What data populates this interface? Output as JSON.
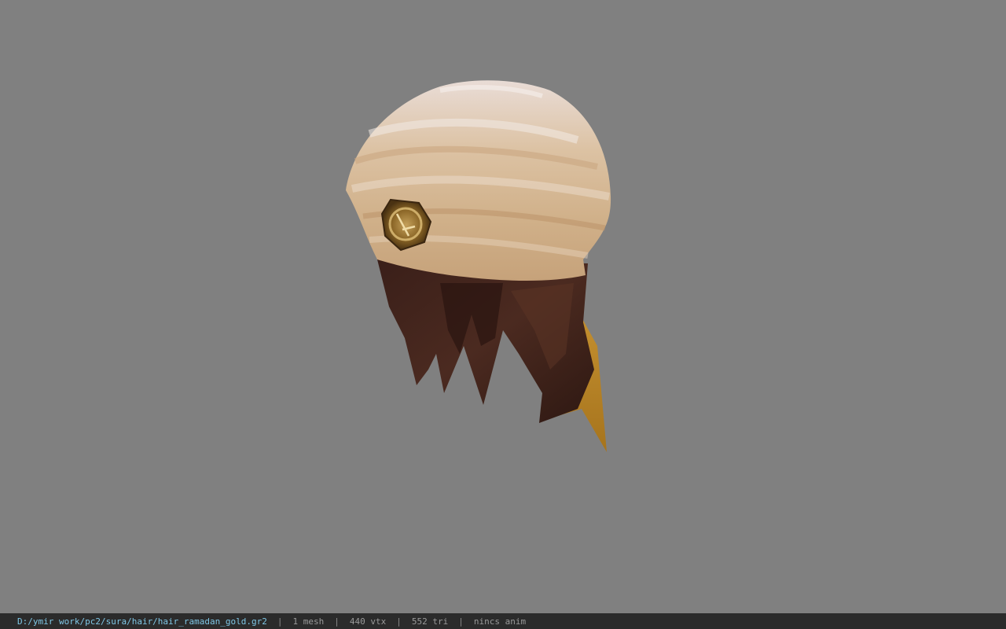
{
  "viewport": {
    "background_color": "#808080",
    "model_description_icon": "hair-model-icon"
  },
  "status_bar": {
    "file_path": "D:/ymir work/pc2/sura/hair/hair_ramadan_gold.gr2",
    "separator": "|",
    "mesh_count": "1 mesh",
    "vertex_count": "440 vtx",
    "triangle_count": "552 tri",
    "anim_status": "nincs anim"
  }
}
